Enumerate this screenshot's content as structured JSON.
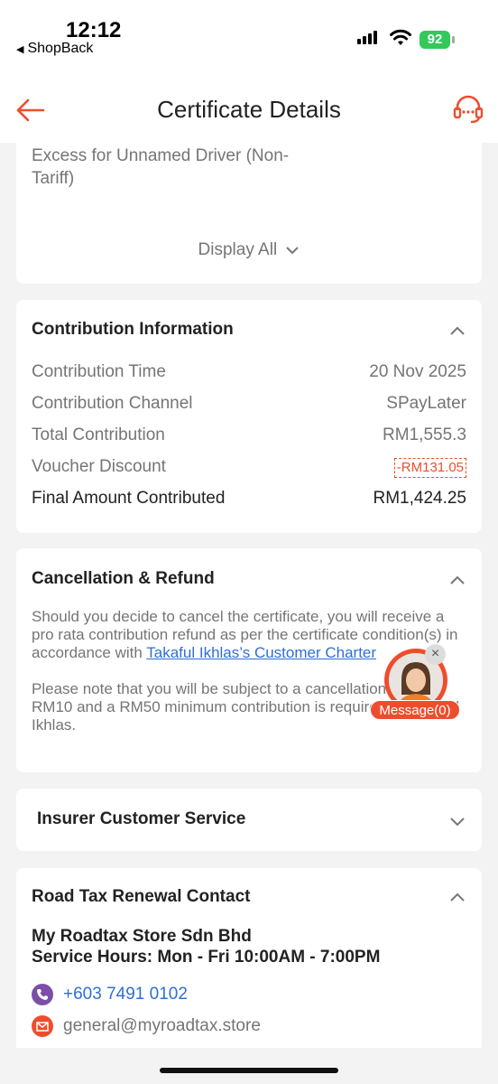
{
  "status_bar": {
    "time": "12:12",
    "back_app": "ShopBack",
    "battery": "92"
  },
  "nav": {
    "title": "Certificate Details"
  },
  "coverage": {
    "text": "Excess for Unnamed Driver (Non-Tariff)",
    "display_all": "Display All"
  },
  "contribution": {
    "title": "Contribution Information",
    "rows": [
      {
        "label": "Contribution Time",
        "value": "20 Nov 2025"
      },
      {
        "label": "Contribution Channel",
        "value": "SPayLater"
      },
      {
        "label": "Total Contribution",
        "value": "RM1,555.3"
      },
      {
        "label": "Voucher Discount",
        "value": "-RM131.05"
      },
      {
        "label": "Final Amount Contributed",
        "value": "RM1,424.25"
      }
    ]
  },
  "cancellation": {
    "title": "Cancellation & Refund",
    "para1_prefix": "Should you decide to cancel the certificate, you will receive a pro rata contribution refund as per the certificate condition(s) in accordance with ",
    "para1_link": "Takaful Ikhlas’s Customer Charter",
    "para2": "Please note that you will be subject to a cancellation fee of RM10 and a RM50 minimum contribution is required by Takaful Ikhlas."
  },
  "insurer": {
    "title": "Insurer Customer Service"
  },
  "roadtax": {
    "title": "Road Tax Renewal Contact",
    "store_name": "My Roadtax Store Sdn Bhd",
    "service_hours": "Service Hours: Mon - Fri 10:00AM - 7:00PM",
    "phone": "+603 7491 0102",
    "email": "general@myroadtax.store"
  },
  "chat": {
    "label": "Message(0)",
    "close": "×"
  },
  "colors": {
    "accent": "#ee4d2d",
    "link": "#2f6fd6",
    "phone_icon": "#7b4fa8"
  },
  "icons": [
    "back-arrow-icon",
    "headset-icon",
    "chevron-down-icon",
    "chevron-up-icon",
    "phone-icon",
    "mail-icon",
    "close-icon"
  ]
}
